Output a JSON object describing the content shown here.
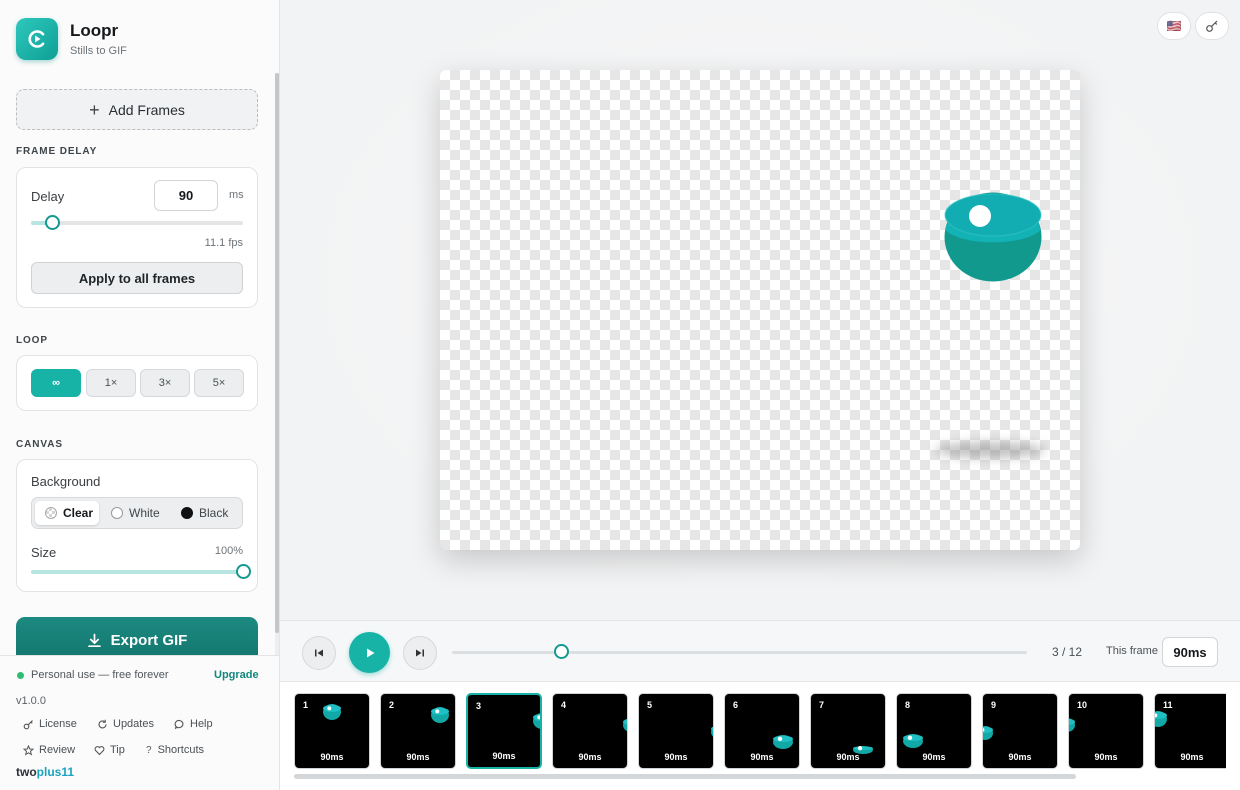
{
  "app": {
    "name": "Loopr",
    "tagline": "Stills to GIF"
  },
  "sidebar": {
    "add_frames_label": "Add Frames",
    "frame_delay": {
      "section_title": "FRAME DELAY",
      "label": "Delay",
      "value": "90",
      "unit": "ms",
      "fps": "11.1 fps",
      "slider_fraction": 0.1,
      "apply_label": "Apply to all frames"
    },
    "loop": {
      "section_title": "LOOP",
      "options": [
        "∞",
        "1×",
        "3×",
        "5×"
      ],
      "selected": "∞"
    },
    "canvas": {
      "section_title": "CANVAS",
      "background_label": "Background",
      "background_options": [
        "Clear",
        "White",
        "Black"
      ],
      "background_selected": "Clear",
      "size_label": "Size",
      "size_value": "100%",
      "size_fraction": 1.0
    },
    "export_label": "Export GIF",
    "footer": {
      "status": "Personal use — free forever",
      "upgrade": "Upgrade",
      "version": "v1.0.0",
      "links": [
        "License",
        "Updates",
        "Help",
        "Review",
        "Tip",
        "Shortcuts"
      ],
      "maker_a": "two",
      "maker_b": "plus11"
    }
  },
  "header": {
    "flag": "🇺🇸"
  },
  "player": {
    "position_fraction": 0.19,
    "counter": "3 / 12",
    "this_frame_label": "This frame",
    "this_frame_value": "90ms"
  },
  "frames": [
    {
      "num": "1",
      "ms": "90ms"
    },
    {
      "num": "2",
      "ms": "90ms"
    },
    {
      "num": "3",
      "ms": "90ms"
    },
    {
      "num": "4",
      "ms": "90ms"
    },
    {
      "num": "5",
      "ms": "90ms"
    },
    {
      "num": "6",
      "ms": "90ms"
    },
    {
      "num": "7",
      "ms": "90ms"
    },
    {
      "num": "8",
      "ms": "90ms"
    },
    {
      "num": "9",
      "ms": "90ms"
    },
    {
      "num": "10",
      "ms": "90ms"
    },
    {
      "num": "11",
      "ms": "90ms"
    }
  ],
  "current_frame": "3",
  "colors": {
    "accent": "#17b3a7",
    "accent_dark": "#13756d",
    "ball": "#11a8a5",
    "status_ok": "#2ebd72"
  }
}
